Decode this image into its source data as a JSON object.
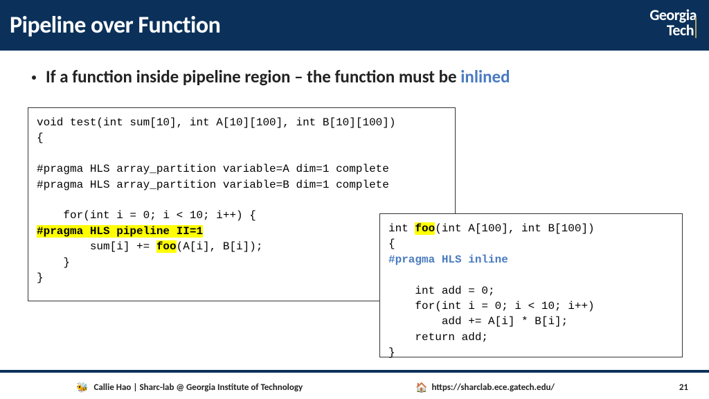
{
  "header": {
    "title": "Pipeline over Function",
    "logo_top": "Georgia",
    "logo_bot": "Tech"
  },
  "bullet": {
    "pre": "If a function inside pipeline region – the function must be ",
    "accent": "inlined"
  },
  "code1": {
    "l1": "void test(int sum[10], int A[10][100], int B[10][100])",
    "l2": "{",
    "l3": "",
    "l4": "#pragma HLS array_partition variable=A dim=1 complete",
    "l5": "#pragma HLS array_partition variable=B dim=1 complete",
    "l6": "",
    "l7": "    for(int i = 0; i < 10; i++) {",
    "l8": "#pragma HLS pipeline II=1",
    "l9a": "        sum[i] += ",
    "l9b": "foo",
    "l9c": "(A[i], B[i]);",
    "l10": "    }",
    "l11": "}"
  },
  "code2": {
    "l1a": "int ",
    "l1b": "foo",
    "l1c": "(int A[100], int B[100])",
    "l2": "{",
    "l3": "#pragma HLS inline",
    "l4": "",
    "l5": "    int add = 0;",
    "l6": "    for(int i = 0; i < 10; i++)",
    "l7": "        add += A[i] * B[i];",
    "l8": "    return add;",
    "l9": "}"
  },
  "footer": {
    "left": "Callie Hao | Sharc-lab @ Georgia Institute of Technology",
    "mid": "https://sharclab.ece.gatech.edu/",
    "page": "21"
  }
}
